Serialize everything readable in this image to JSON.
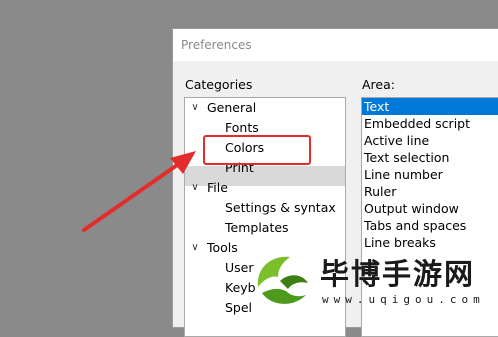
{
  "window": {
    "title": "Preferences"
  },
  "categories": {
    "label": "Categories",
    "tree": [
      {
        "label": "General",
        "expanded": true
      },
      {
        "label": "Fonts"
      },
      {
        "label": "Colors",
        "selected": true
      },
      {
        "label": "Print"
      },
      {
        "label": "File",
        "expanded": true
      },
      {
        "label": "Settings & syntax"
      },
      {
        "label": "Templates"
      },
      {
        "label": "Tools",
        "expanded": true
      },
      {
        "label": "User"
      },
      {
        "label": "Keyb"
      },
      {
        "label": "Spel"
      }
    ]
  },
  "area": {
    "label": "Area:",
    "items": [
      "Text",
      "Embedded script",
      "Active line",
      "Text selection",
      "Line number",
      "Ruler",
      "Output window",
      "Tabs and spaces",
      "Line breaks"
    ],
    "selected": "Text"
  },
  "watermark": {
    "text": "毕博手游网",
    "url": "www.uqigou.com",
    "logo": "leaf-logo-icon"
  },
  "colors": {
    "accent": "#0078d7",
    "highlight": "#e32d2d",
    "selection_row": "#d9d9d9"
  },
  "icons": {
    "expand": "chevron-down-icon"
  }
}
